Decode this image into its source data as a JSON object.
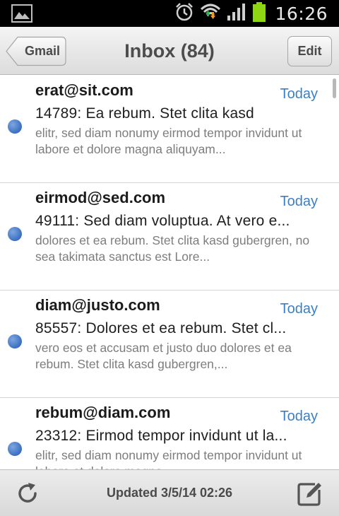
{
  "status_bar": {
    "time": "16:26"
  },
  "header": {
    "back_label": "Gmail",
    "title": "Inbox (84)",
    "edit_label": "Edit"
  },
  "messages": [
    {
      "from": "erat@sit.com",
      "date": "Today",
      "subject": "14789: Ea rebum. Stet clita kasd",
      "preview": "elitr, sed diam nonumy eirmod tempor invidunt ut labore et dolore magna aliquyam..."
    },
    {
      "from": "eirmod@sed.com",
      "date": "Today",
      "subject": "49111: Sed diam voluptua. At vero e...",
      "preview": "dolores et ea rebum. Stet clita kasd gubergren, no sea takimata sanctus est Lore..."
    },
    {
      "from": "diam@justo.com",
      "date": "Today",
      "subject": "85557: Dolores et ea rebum. Stet cl...",
      "preview": "vero eos et accusam et justo duo dolores et ea rebum. Stet clita kasd gubergren,..."
    },
    {
      "from": "rebum@diam.com",
      "date": "Today",
      "subject": "23312: Eirmod tempor invidunt ut la...",
      "preview": "elitr, sed diam nonumy eirmod tempor invidunt ut labore et dolore magna"
    }
  ],
  "footer": {
    "updated_text": "Updated 3/5/14 02:26"
  },
  "colors": {
    "accent_date": "#3d7fc2",
    "unread_dot": "#3a6fc2",
    "battery": "#8ed614"
  },
  "icons": {
    "status_left": "gallery-icon",
    "status_right": [
      "alarm-icon",
      "wifi-icon",
      "signal-icon",
      "battery-icon"
    ],
    "footer_left": "refresh-icon",
    "footer_right": "compose-icon"
  }
}
